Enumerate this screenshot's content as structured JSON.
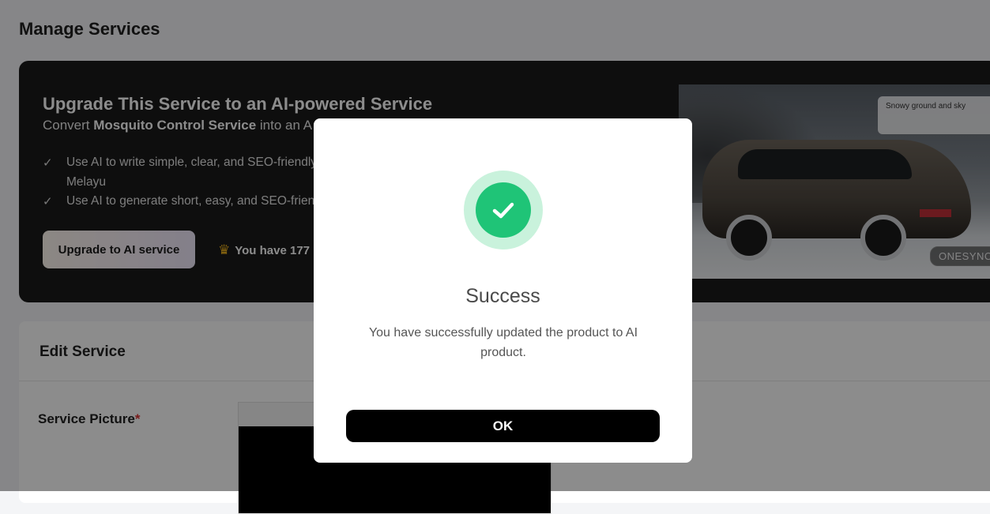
{
  "page": {
    "title": "Manage Services"
  },
  "banner": {
    "title": "Upgrade This Service to an AI-powered Service",
    "subtitle_prefix": "Convert ",
    "service_name": "Mosquito Control Service",
    "subtitle_suffix": " into an A",
    "features": [
      "Use AI to write simple, clear, and SEO-friendly Melayu",
      "Use AI to generate short, easy, and SEO-frien"
    ],
    "upgrade_button": "Upgrade to AI service",
    "credits_text": "You have 177",
    "image": {
      "caption": "Snowy ground and sky",
      "brand_tag": "ONESYNC"
    }
  },
  "edit": {
    "title": "Edit Service",
    "picture_label": "Service Picture",
    "required_mark": "*"
  },
  "modal": {
    "title": "Success",
    "message": "You have successfully updated the product to AI product.",
    "ok_button": "OK"
  },
  "colors": {
    "success": "#1fc477",
    "success_ring": "#c9f2dc",
    "banner_bg": "#1b1b1b",
    "ok_button_bg": "#000000"
  }
}
